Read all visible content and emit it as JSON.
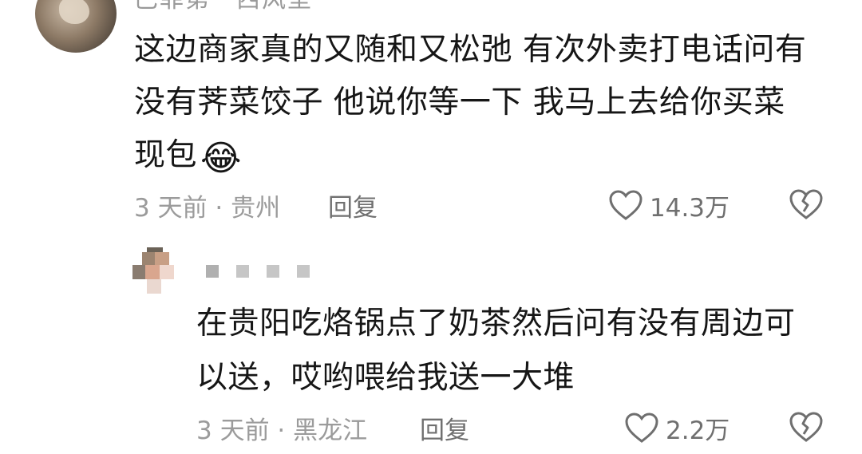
{
  "comment": {
    "username": "巴菲第一西风垒",
    "text_line1": "这边商家真的又随和又松弛 有次外卖打电话问有",
    "text_line2": "没有荠菜饺子 他说你等一下 我马上去给你买菜",
    "text_line3": "现包",
    "emoji": "😂",
    "time_location": "3 天前 · 贵州",
    "reply_label": "回复",
    "likes": "14.3万"
  },
  "reply": {
    "text_line1": "在贵阳吃烙锅点了奶茶然后问有没有周边可",
    "text_line2": "以送，哎哟喂给我送一大堆",
    "time_location": "3 天前 · 黑龙江",
    "reply_label": "回复",
    "likes": "2.2万"
  },
  "icons": {
    "like": "heart-outline-icon",
    "dislike": "broken-heart-icon"
  },
  "colors": {
    "text": "#161616",
    "meta": "#9b9b9b",
    "icon": "#6f6f6f"
  }
}
